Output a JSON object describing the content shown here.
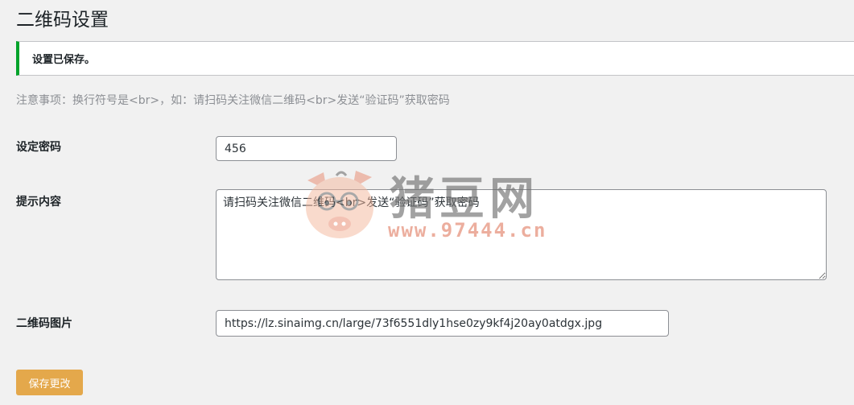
{
  "page": {
    "title": "二维码设置"
  },
  "notice": {
    "text": "设置已保存。"
  },
  "hint": {
    "text": "注意事项：换行符号是<br>，如：请扫码关注微信二维码<br>发送“验证码”获取密码"
  },
  "form": {
    "password": {
      "label": "设定密码",
      "value": "456"
    },
    "tip_content": {
      "label": "提示内容",
      "value": "请扫码关注微信二维码<br>发送“验证码”获取密码"
    },
    "qr_image": {
      "label": "二维码图片",
      "value": "https://lz.sinaimg.cn/large/73f6551dly1hse0zy9kf4j20ay0atdgx.jpg"
    },
    "save_label": "保存更改"
  },
  "watermark": {
    "brand": "猪豆网",
    "url": "www.97444.cn"
  },
  "colors": {
    "notice_accent": "#00a32a",
    "save_button": "#e4a84b",
    "hint_text": "#8c8f94"
  }
}
